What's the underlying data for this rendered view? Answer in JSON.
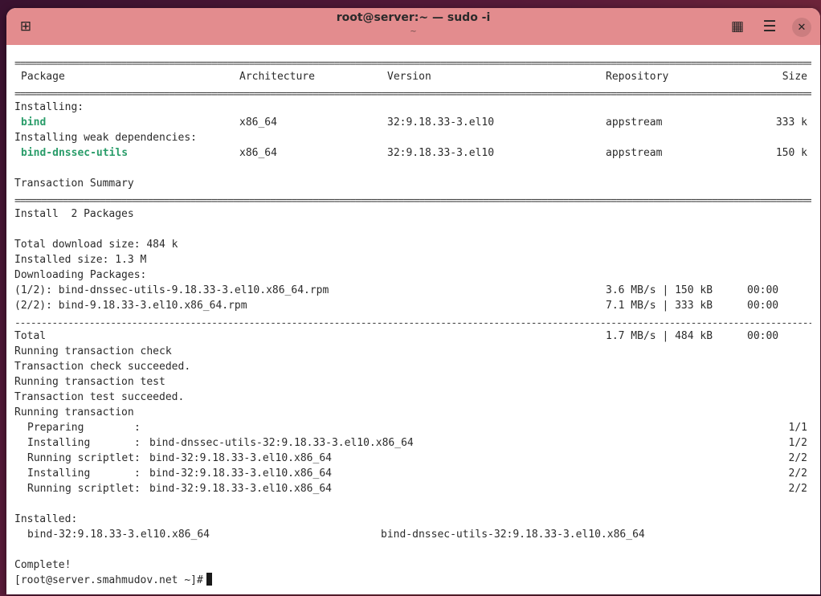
{
  "window": {
    "title": "root@server:~ — sudo -i",
    "subtitle": "~",
    "new_tab_icon": "⊞",
    "grid_icon": "▦",
    "menu_icon": "☰",
    "close_icon": "✕"
  },
  "separators": {
    "double": "========================================================================================================================================================",
    "single": "--------------------------------------------------------------------------------------------------------------------------------------------------------"
  },
  "table": {
    "headers": [
      "Package",
      "Architecture",
      "Version",
      "Repository",
      "Size"
    ],
    "installing_label": "Installing:",
    "weak_label": "Installing weak dependencies:",
    "rows": [
      {
        "name": "bind",
        "arch": "x86_64",
        "version": "32:9.18.33-3.el10",
        "repo": "appstream",
        "size": "333 k"
      },
      {
        "name": "bind-dnssec-utils",
        "arch": "x86_64",
        "version": "32:9.18.33-3.el10",
        "repo": "appstream",
        "size": "150 k"
      }
    ]
  },
  "summary": {
    "title": "Transaction Summary",
    "install": "Install  2 Packages",
    "download_size": "Total download size: 484 k",
    "installed_size": "Installed size: 1.3 M",
    "downloading": "Downloading Packages:"
  },
  "downloads": [
    {
      "file": "(1/2): bind-dnssec-utils-9.18.33-3.el10.x86_64.rpm",
      "rate": "3.6 MB/s | 150 kB",
      "time": "00:00"
    },
    {
      "file": "(2/2): bind-9.18.33-3.el10.x86_64.rpm",
      "rate": "7.1 MB/s | 333 kB",
      "time": "00:00"
    }
  ],
  "total": {
    "label": "Total",
    "rate": "1.7 MB/s | 484 kB",
    "time": "00:00"
  },
  "transaction_lines": [
    "Running transaction check",
    "Transaction check succeeded.",
    "Running transaction test",
    "Transaction test succeeded.",
    "Running transaction"
  ],
  "steps": [
    {
      "action": "Preparing        :",
      "item": "",
      "count": "1/1"
    },
    {
      "action": "Installing       :",
      "item": "bind-dnssec-utils-32:9.18.33-3.el10.x86_64",
      "count": "1/2"
    },
    {
      "action": "Running scriptlet:",
      "item": "bind-32:9.18.33-3.el10.x86_64",
      "count": "2/2"
    },
    {
      "action": "Installing       :",
      "item": "bind-32:9.18.33-3.el10.x86_64",
      "count": "2/2"
    },
    {
      "action": "Running scriptlet:",
      "item": "bind-32:9.18.33-3.el10.x86_64",
      "count": "2/2"
    }
  ],
  "installed": {
    "label": "Installed:",
    "items": [
      "bind-32:9.18.33-3.el10.x86_64",
      "bind-dnssec-utils-32:9.18.33-3.el10.x86_64"
    ]
  },
  "complete": "Complete!",
  "prompt": "[root@server.smahmudov.net ~]#"
}
